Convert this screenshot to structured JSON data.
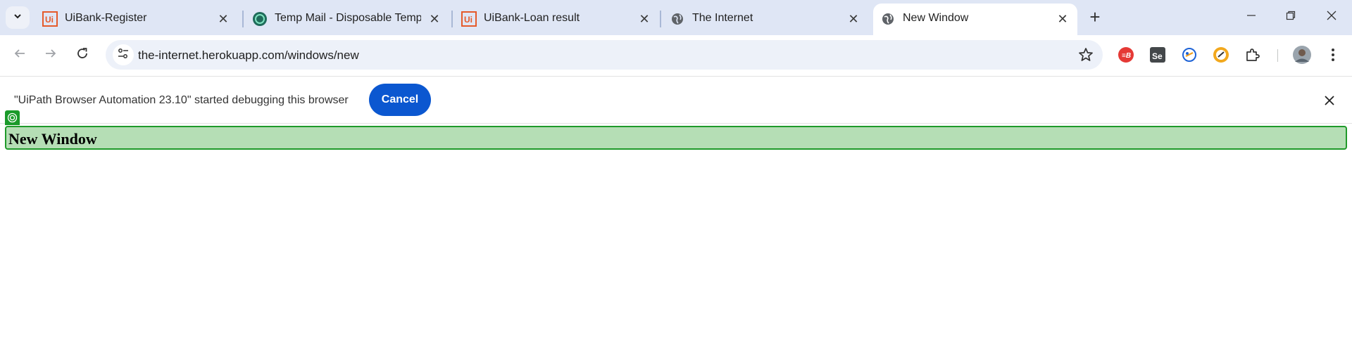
{
  "tabs": [
    {
      "title": "UiBank-Register",
      "favicon": "uipath-icon",
      "active": false
    },
    {
      "title": "Temp Mail - Disposable Tempor",
      "favicon": "tempmail-icon",
      "active": false
    },
    {
      "title": "UiBank-Loan result",
      "favicon": "uipath-icon",
      "active": false
    },
    {
      "title": "The Internet",
      "favicon": "globe-icon",
      "active": false
    },
    {
      "title": "New Window",
      "favicon": "globe-icon",
      "active": true
    }
  ],
  "toolbar": {
    "url": "the-internet.herokuapp.com/windows/new"
  },
  "infobar": {
    "message": "\"UiPath Browser Automation 23.10\" started debugging this browser",
    "cancel_label": "Cancel"
  },
  "page": {
    "heading": "New Window"
  },
  "colors": {
    "tabstrip_bg": "#dfe6f5",
    "accent_blue": "#0b57d0",
    "highlight_green": "#b5deb5",
    "highlight_border": "#1f9a2a"
  }
}
